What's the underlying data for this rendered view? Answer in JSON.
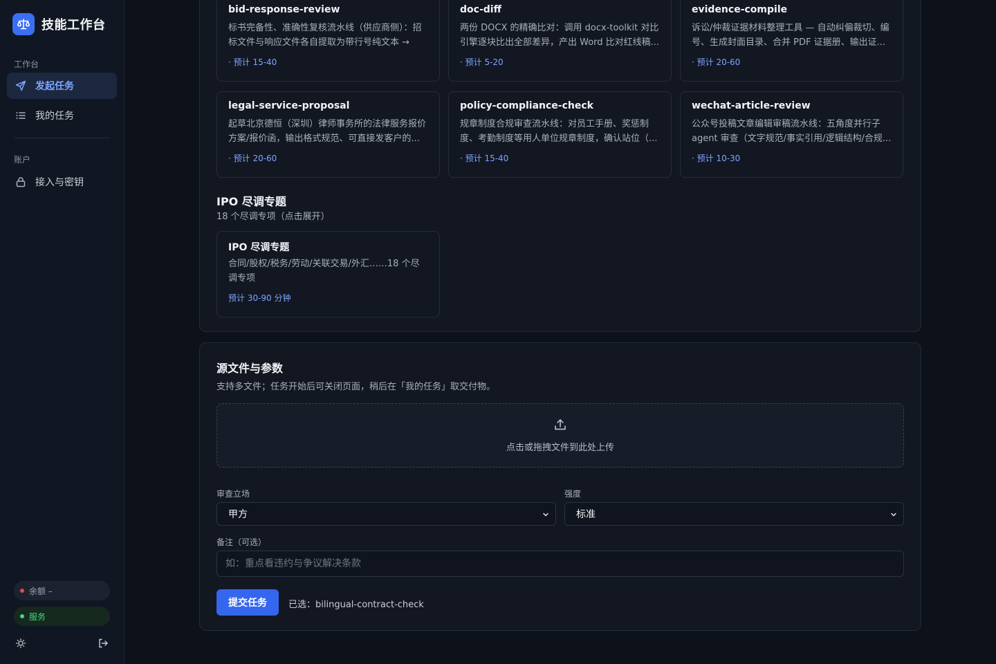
{
  "brand": {
    "title": "技能工作台"
  },
  "sidebar": {
    "section_workspace": "工作台",
    "items": [
      {
        "label": "发起任务",
        "icon": "send-icon"
      },
      {
        "label": "我的任务",
        "icon": "list-icon"
      }
    ],
    "section_account": "账户",
    "account_items": [
      {
        "label": "接入与密钥",
        "icon": "lock-icon"
      }
    ],
    "balance": "余额 –",
    "service": "服务"
  },
  "skills": [
    {
      "name": "bid-response-review",
      "desc": "标书完备性、准确性复核流水线（供应商侧）：招标文件与响应文件各自提取为带行号纯文本 → 版...",
      "eta": "· 预计 15-40"
    },
    {
      "name": "doc-diff",
      "desc": "两份 DOCX 的精确比对：调用 docx-toolkit 对比引擎逐块比出全部差异，产出 Word 比对红线稿...",
      "eta": "· 预计 5-20"
    },
    {
      "name": "evidence-compile",
      "desc": "诉讼/仲裁证据材料整理工具 — 自动纠偏裁切、编号、生成封面目录、合并 PDF 证据册、输出证...",
      "eta": "· 预计 20-60"
    },
    {
      "name": "legal-service-proposal",
      "desc": "起草北京德恒（深圳）律师事务所的法律服务报价方案/报价函，输出格式规范、可直接发客户的...",
      "eta": "· 预计 20-60"
    },
    {
      "name": "policy-compliance-check",
      "desc": "规章制度合规审查流水线：对员工手册、奖惩制度、考勤制度等用人单位规章制度，确认站位（...",
      "eta": "· 预计 15-40"
    },
    {
      "name": "wechat-article-review",
      "desc": "公众号投稿文章编辑审稿流水线：五角度并行子 agent 审查（文字规范/事实引用/逻辑结构/合规...",
      "eta": "· 预计 10-30"
    }
  ],
  "ipo_group": {
    "title": "IPO 尽调专题",
    "subtitle": "18 个尽调专项（点击展开）",
    "card": {
      "name": "IPO 尽调专题",
      "desc": "合同/股权/税务/劳动/关联交易/外汇……18 个尽调专项",
      "eta": "预计 30-90 分钟"
    }
  },
  "source": {
    "title": "源文件与参数",
    "subtitle": "支持多文件；任务开始后可关闭页面，稍后在「我的任务」取交付物。",
    "dropzone_text": "点击或拖拽文件到此处上传",
    "stance_label": "审查立场",
    "stance_value": "甲方",
    "strength_label": "强度",
    "strength_value": "标准",
    "note_label": "备注（可选）",
    "note_placeholder": "如：重点看违约与争议解决条款",
    "submit_label": "提交任务",
    "selected": "已选：bilingual-contract-check"
  },
  "colors": {
    "accent": "#3566ee",
    "link": "#7ea6ff",
    "service_ok": "#4ad27b",
    "balance_dot": "#e5484d"
  }
}
